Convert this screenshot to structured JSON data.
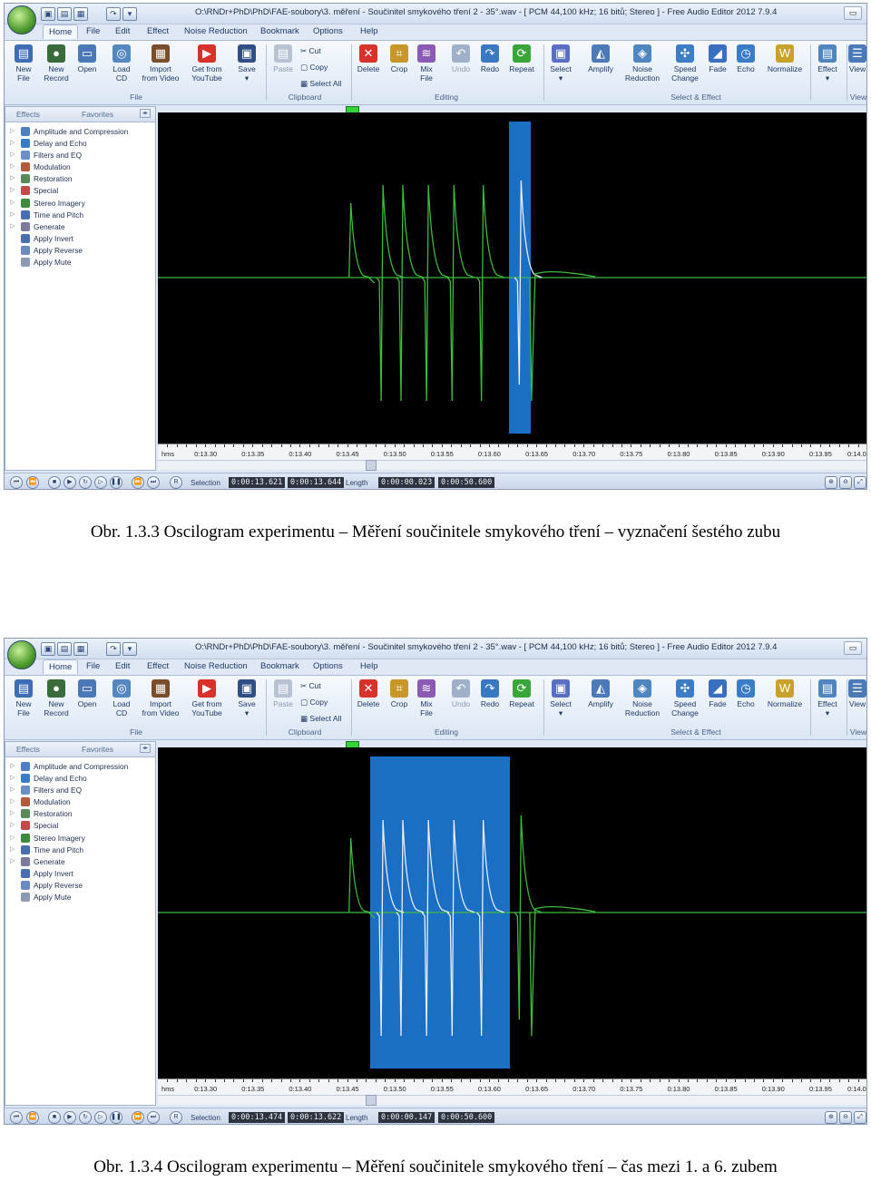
{
  "window_title": "O:\\RNDr+PhD\\PhD\\FAE-soubory\\3. měření - Součinitel smykového tření 2 - 35°.wav - [ PCM 44,100 kHz; 16 bitů; Stereo ] - Free Audio Editor 2012 7.9.4",
  "menu": [
    "Home",
    "File",
    "Edit",
    "Effect",
    "Noise Reduction",
    "Bookmark",
    "Options",
    "Help"
  ],
  "ribbon": {
    "file_buttons": [
      {
        "l1": "New",
        "l2": "File",
        "icon": "new-file-icon",
        "color": "#3d6db6"
      },
      {
        "l1": "New",
        "l2": "Record",
        "icon": "record-icon",
        "color": "#3a6b3a"
      },
      {
        "l1": "Open",
        "l2": "",
        "icon": "open-folder-icon",
        "color": "#4a78b8"
      },
      {
        "l1": "Load",
        "l2": "CD",
        "icon": "cd-icon",
        "color": "#5588c0"
      },
      {
        "l1": "Import",
        "l2": "from Video",
        "icon": "film-icon",
        "color": "#7a4e2a"
      },
      {
        "l1": "Get from",
        "l2": "YouTube",
        "icon": "youtube-icon",
        "color": "#d9302a"
      },
      {
        "l1": "Save",
        "l2": "▾",
        "icon": "save-icon",
        "color": "#2f4f86"
      }
    ],
    "file_group": "File",
    "paste": "Paste",
    "clipboard": [
      "Cut",
      "Copy",
      "Select All"
    ],
    "clipboard_group": "Clipboard",
    "edit_buttons": [
      {
        "l1": "Delete",
        "l2": "",
        "icon": "delete-icon",
        "color": "#d8322c"
      },
      {
        "l1": "Crop",
        "l2": "",
        "icon": "crop-icon",
        "color": "#c9962a"
      },
      {
        "l1": "Mix",
        "l2": "File",
        "icon": "mix-icon",
        "color": "#8a5ab4"
      },
      {
        "l1": "Undo",
        "l2": "",
        "icon": "undo-icon",
        "color": "#9fb0c8"
      },
      {
        "l1": "Redo",
        "l2": "",
        "icon": "redo-icon",
        "color": "#3a78c4"
      },
      {
        "l1": "Repeat",
        "l2": "",
        "icon": "repeat-icon",
        "color": "#3aa63a"
      }
    ],
    "edit_group": "Editing",
    "select_buttons": [
      {
        "l1": "Select",
        "l2": "▾",
        "icon": "select-icon",
        "color": "#5b6fc2"
      },
      {
        "l1": "Amplify",
        "l2": "",
        "icon": "amplify-icon",
        "color": "#4c7ab8"
      },
      {
        "l1": "Noise",
        "l2": "Reduction",
        "icon": "noise-icon",
        "color": "#4f86c0"
      },
      {
        "l1": "Speed",
        "l2": "Change",
        "icon": "speed-icon",
        "color": "#3d7cc6"
      },
      {
        "l1": "Fade",
        "l2": "",
        "icon": "fade-icon",
        "color": "#3a6fc0"
      },
      {
        "l1": "Echo",
        "l2": "",
        "icon": "echo-icon",
        "color": "#3a7cc8"
      },
      {
        "l1": "Normalize",
        "l2": "",
        "icon": "normalize-icon",
        "color": "#c8a22a"
      }
    ],
    "select_group": "Select & Effect",
    "effect_button": {
      "l1": "Effect",
      "l2": "▾"
    },
    "view_button": {
      "l1": "View",
      "l2": ""
    },
    "view_group": "View"
  },
  "panel": {
    "tab_effects": "Effects",
    "tab_favorites": "Favorites",
    "items": [
      {
        "label": "Amplitude and Compression",
        "color": "#4f7fc0"
      },
      {
        "label": "Delay and Echo",
        "color": "#3a7cc8"
      },
      {
        "label": "Filters and EQ",
        "color": "#6a8fc6"
      },
      {
        "label": "Modulation",
        "color": "#b05b3b"
      },
      {
        "label": "Restoration",
        "color": "#5a8a5a"
      },
      {
        "label": "Special",
        "color": "#c44a4a"
      },
      {
        "label": "Stereo Imagery",
        "color": "#3f8a3f"
      },
      {
        "label": "Time and Pitch",
        "color": "#4a6fb0"
      },
      {
        "label": "Generate",
        "color": "#7a7a9a"
      },
      {
        "label": "Apply Invert",
        "color": "#4a6fb0"
      },
      {
        "label": "Apply Reverse",
        "color": "#6a8ac0"
      },
      {
        "label": "Apply Mute",
        "color": "#8a9ab0"
      }
    ]
  },
  "ruler_labels": [
    "hms",
    "0:13.30",
    "0:13.35",
    "0:13.40",
    "0:13.45",
    "0:13.50",
    "0:13.55",
    "0:13.60",
    "0:13.65",
    "0:13.70",
    "0:13.75",
    "0:13.80",
    "0:13.85",
    "0:13.90",
    "0:13.95",
    "0:14.0"
  ],
  "status_labels": {
    "selection": "Selection",
    "length": "Length"
  },
  "screens": [
    {
      "selection_start": "0:00:13.621",
      "selection_end": "0:00:13.644",
      "length": "0:00:00.023",
      "total": "0:00:50.600",
      "selection_range_s": [
        13.621,
        13.644
      ],
      "caption": "Obr. 1.3.3 Oscilogram experimentu – Měření součinitele smykového tření – vyznačení šestého zubu"
    },
    {
      "selection_start": "0:00:13.474",
      "selection_end": "0:00:13.622",
      "length": "0:00:00.147",
      "total": "0:00:50.600",
      "selection_range_s": [
        13.474,
        13.622
      ],
      "caption": "Obr. 1.3.4 Oscilogram experimentu – Měření součinitele smykového tření – čas mezi 1. a 6. zubem"
    }
  ],
  "waveform": {
    "view_range_s": [
      13.25,
      14.0
    ],
    "pulse_times_s": [
      13.454,
      13.487,
      13.508,
      13.535,
      13.562,
      13.593,
      13.633
    ],
    "colors": {
      "wave": "#3dbb3d",
      "wave_selected": "#e8eef8",
      "selection": "#1a6fc4",
      "background": "#000000"
    }
  }
}
